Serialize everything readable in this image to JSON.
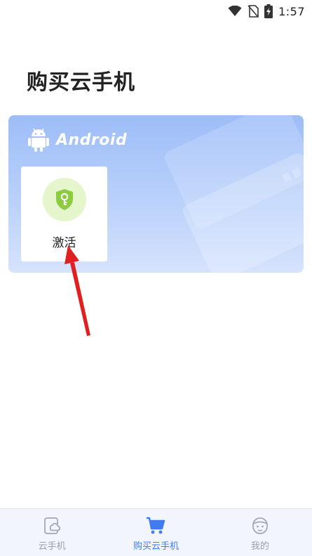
{
  "status_bar": {
    "time": "1:57"
  },
  "page": {
    "title": "购买云手机"
  },
  "card": {
    "os_label": "Android",
    "activate_label": "激活"
  },
  "bottom_nav": {
    "items": [
      {
        "label": "云手机",
        "icon": "cloud-phone-icon",
        "active": false
      },
      {
        "label": "购买云手机",
        "icon": "cart-icon",
        "active": true
      },
      {
        "label": "我的",
        "icon": "profile-face-icon",
        "active": false
      }
    ]
  },
  "colors": {
    "accent": "#3f7cf2",
    "card_gradient_top": "#9dbdf8",
    "card_gradient_bottom": "#d6e3fd",
    "shield_green": "#8ccc3f",
    "annotation_arrow": "#e02020"
  }
}
